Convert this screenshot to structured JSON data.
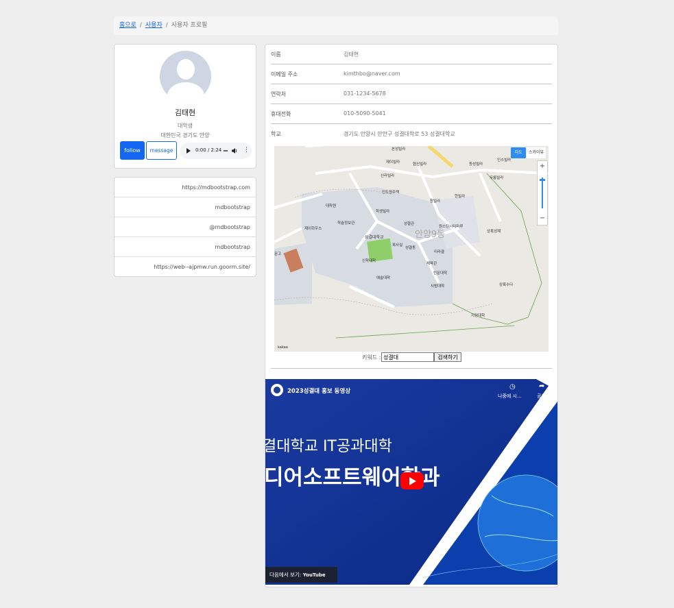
{
  "breadcrumb": {
    "home": "홈으로",
    "users": "사용자",
    "current": "사용자 프로필"
  },
  "profile": {
    "name": "김태현",
    "role": "대학생",
    "location": "대한민국 경기도 안양",
    "follow_label": "follow",
    "message_label": "message",
    "audio_time": "0:00 / 2:24"
  },
  "links": [
    "https://mdbootstrap.com",
    "mdbootstrap",
    "@mdbootstrap",
    "mdbootstrap",
    "https://web--ajpmw.run.goorm.site/"
  ],
  "info": {
    "name_label": "이름",
    "name_value": "김태현",
    "email_label": "이메일 주소",
    "email_value": "kimthbo@naver.com",
    "phone_label": "연락처",
    "phone_value": "031-1234-5678",
    "mobile_label": "휴대전화",
    "mobile_value": "010-5090-5041",
    "school_label": "학교",
    "school_value": "경기도 안양시 만안구 성결대학로 53 성결대학교"
  },
  "map": {
    "type_map": "지도",
    "type_sky": "스카이뷰",
    "zoom_in": "+",
    "zoom_out": "−",
    "copyright": "kakao",
    "labels": [
      "본성빌라",
      "제이빌라",
      "협신빌라",
      "신라빌라",
      "인도원주택",
      "대학원",
      "제이하우스",
      "학술정보관",
      "성결대학교",
      "성결관",
      "복사실",
      "신학대학",
      "체육관",
      "예술대학",
      "인문대학",
      "사범대학",
      "학생빌라",
      "성결동",
      "미라클",
      "원스틴시티마루",
      "안양9동",
      "지정대학",
      "상록수다",
      "문고",
      "상록성제",
      "동성빌라",
      "무릉빌라",
      "한빌라",
      "인스빌라",
      "참빌라"
    ]
  },
  "search": {
    "keyword_label": "키워드 :",
    "keyword_value": "성결대",
    "button_label": "검색하기"
  },
  "video": {
    "title": "2023성결대 홍보 동영상",
    "watch_later": "나중에 시...",
    "share": "공유",
    "line1": "결대학교 IT공과대학",
    "line2": "디어소프트웨어학과",
    "watch_on": "다음에서 보기:",
    "youtube": "YouTube"
  },
  "colors": {
    "primary": "#1266f1",
    "page_bg": "#eeeeee",
    "video_bg": "#0a2a86",
    "youtube_red": "#ff0000"
  }
}
